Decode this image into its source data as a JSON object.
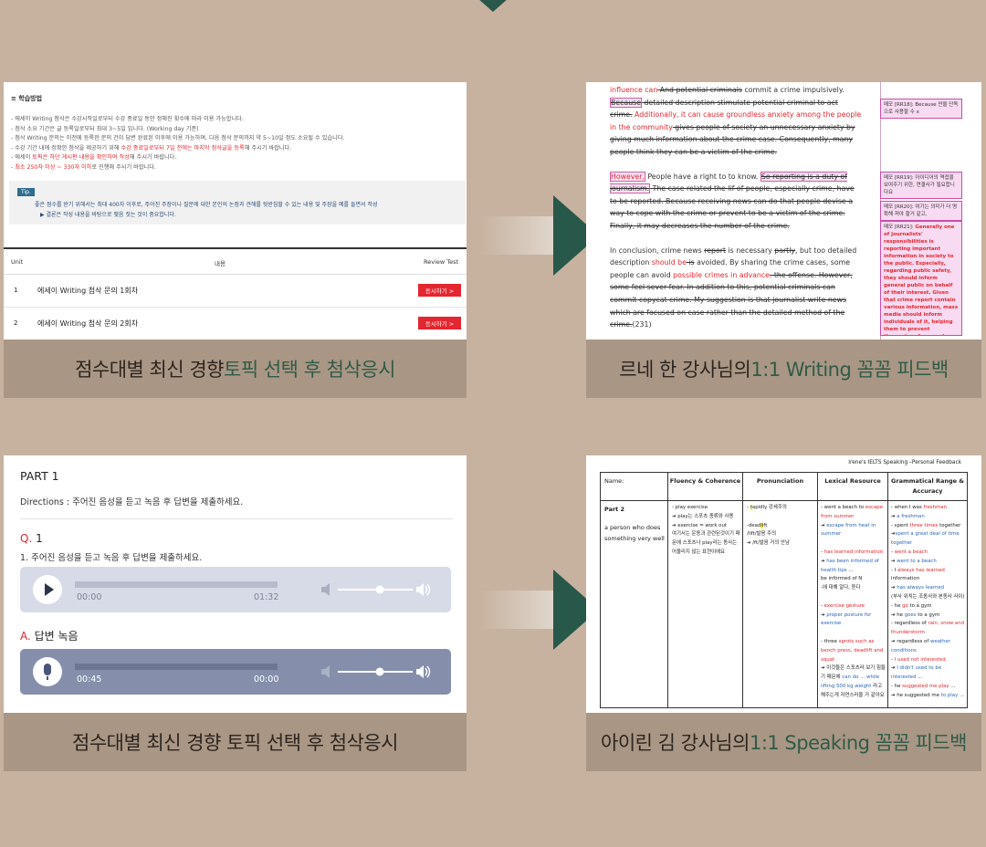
{
  "panel1": {
    "title": "≡ 학습방법",
    "lines": [
      "- 에세이 Writing 첨삭은 수강시작일로부터 수강 종료일 동안 정해진 횟수에 따라 이용 가능합니다.",
      "- 첨삭 소요 기간은 글 등록일로부터 최대 3~5일 입니다. (Working day 기준)",
      "- 첨삭 Writing 문의는 이전에 등록한 문의 건이 답변 완료된 이후에 이용 가능하며, 다음 첨삭 문의까지 약 5~10일 정도 소요될 수 있습니다."
    ],
    "line4_pre": "- 수강 기간 내에 정확한 첨삭을 제공하기 위해 ",
    "line4_red": "수강 종료일로부터 7일 전에는 마지막 첨삭글을 등록",
    "line4_post": "해 주시기 바랍니다.",
    "line5_pre": "- 에세이 ",
    "line5_red": "토픽은 하단 게시판 내용을 확인하여 작성",
    "line5_post": "해 주시기 바랍니다.",
    "line6_red": "- 최소 250자 이상 ~ 330자 이하",
    "line6_post": "로 진행해 주시기 바랍니다.",
    "tip_badge": "Tip.",
    "tip1": "좋은 점수를 받기 위해서는 최대 400자 이후로, 주어진 주장이나 질문에 대한 본인의 논점과 견해를 뒷받침할 수 있는 내용 및 주장을 예를 들면서 작성",
    "tip2": "▶ 결론은 작성 내용을 바탕으로 맺음 짓는 것이 중요합니다.",
    "col_unit": "Unit",
    "col_content": "내용",
    "col_review": "Review Test",
    "rows": [
      {
        "num": "1",
        "name": "에세이 Writing 첨삭 문의 1회차",
        "btn": "응시하기 >"
      },
      {
        "num": "2",
        "name": "에세이 Writing 첨삭 문의 2회차",
        "btn": "응시하기 >"
      }
    ]
  },
  "caption1_pre": "점수대별 최신 경향 ",
  "caption1_hl": "토픽 선택 후 첨삭응시",
  "panel2": {
    "para1": [
      {
        "t": "influence can",
        "c": "red"
      },
      {
        "t": " And potential criminals",
        "c": "strike"
      },
      {
        "t": " commit a crime impulsively. ",
        "c": ""
      },
      {
        "t": "Because",
        "c": "strike box"
      },
      {
        "t": " detailed description stimulate potential criminal to act crime.",
        "c": "strike"
      },
      {
        "t": " Additionally, it can cause groundless anxiety among the people in the community",
        "c": "red"
      },
      {
        "t": " gives people of society an unnecessary anxiety by giving much information about the crime case. Consequently, many people think they can be a victim of the crime.",
        "c": "strike"
      }
    ],
    "para2": [
      {
        "t": "However,",
        "c": "red box"
      },
      {
        "t": " People have a right to to know. ",
        "c": ""
      },
      {
        "t": "So reporting is a duty of journalism.",
        "c": "strike box"
      },
      {
        "t": " The case related the lif of people, especially crime, have to be reported.",
        "c": "strike"
      },
      {
        "t": " Because receiving news can do that people devise a way to cope with the crime or prevent to be a victim of the crime. Finally, it may decreases the number of the crime.",
        "c": "strike"
      }
    ],
    "para3": [
      {
        "t": "In conclusion, crime news ",
        "c": ""
      },
      {
        "t": "report",
        "c": "strike"
      },
      {
        "t": " is necessary ",
        "c": ""
      },
      {
        "t": "partly",
        "c": "strike"
      },
      {
        "t": ", but too detailed description ",
        "c": ""
      },
      {
        "t": "should be",
        "c": "red"
      },
      {
        "t": " is",
        "c": "strike"
      },
      {
        "t": " avoided. By sharing the crime cases, some people can avoid ",
        "c": ""
      },
      {
        "t": "possible crimes in advance",
        "c": "red"
      },
      {
        "t": ". the offense. However, some feel sever fear. In addition to this, potential criminals can commit copycat crime. My suggestion is that journalist write news which are focused on case rather than the detailed method of the crime.",
        "c": "strike"
      },
      {
        "t": "(231)",
        "c": ""
      }
    ],
    "comments": [
      "메모 [RR18]: Because 만을 단독으로 사용할 수 x",
      "메모 [RR19]: 아이디어의 역접을 보여주기 위한, 연결사가 필요합니다요",
      "메모 [RR20]: 여기는 의미가 더 명확해 져야 할거 같고,"
    ],
    "comment4_head": "메모 [RR21]: ",
    "comment4_red": "Generally one of journalists' responsibilities is reporting important information in society to the public. Especially, regarding public safety, they should inform general public on behalf of their interest. Given that crime report contain various information, mass media should inform individuals of it, helping them to prevent themselves from such terrible accidents."
  },
  "caption2_pre": "르네 한 강사님의 ",
  "caption2_hl": "1:1 Writing 꼼꼼 피드백",
  "panel3": {
    "part": "PART 1",
    "directions": "Directions : 주어진 음성을 듣고 녹음 후 답변을 제출하세요.",
    "q_label": "Q.",
    "q_num": " 1",
    "q_text": "1. 주어진 음성을 듣고 녹음 후 답변을 제출하세요.",
    "player1_current": "00:00",
    "player1_total": "01:32",
    "a_label": "A.",
    "a_text": " 답변 녹음",
    "player2_current": "00:45",
    "player2_total": "00:00"
  },
  "caption3_pre": "점수대별 최신 경향 토픽 선택 후 첨삭응시",
  "panel4": {
    "header": "Irene's IELTS Speaking –Personal Feedback",
    "h_name": "Name:",
    "h_fluency": "Fluency & Coherence",
    "h_pron": "Pronunciation",
    "h_lexical": "Lexical Resource",
    "h_gram": "Grammatical Range & Accuracy",
    "part": "Part 2",
    "topic": "a person who does something very well"
  },
  "caption4_pre": "아이린 김 강사님의 ",
  "caption4_hl": "1:1 Speaking 꼼꼼 피드백",
  "colors": {
    "background": "#c7b29f",
    "caption": "#a99684",
    "arrow": "#28584a",
    "accent_red": "#e2262f"
  }
}
